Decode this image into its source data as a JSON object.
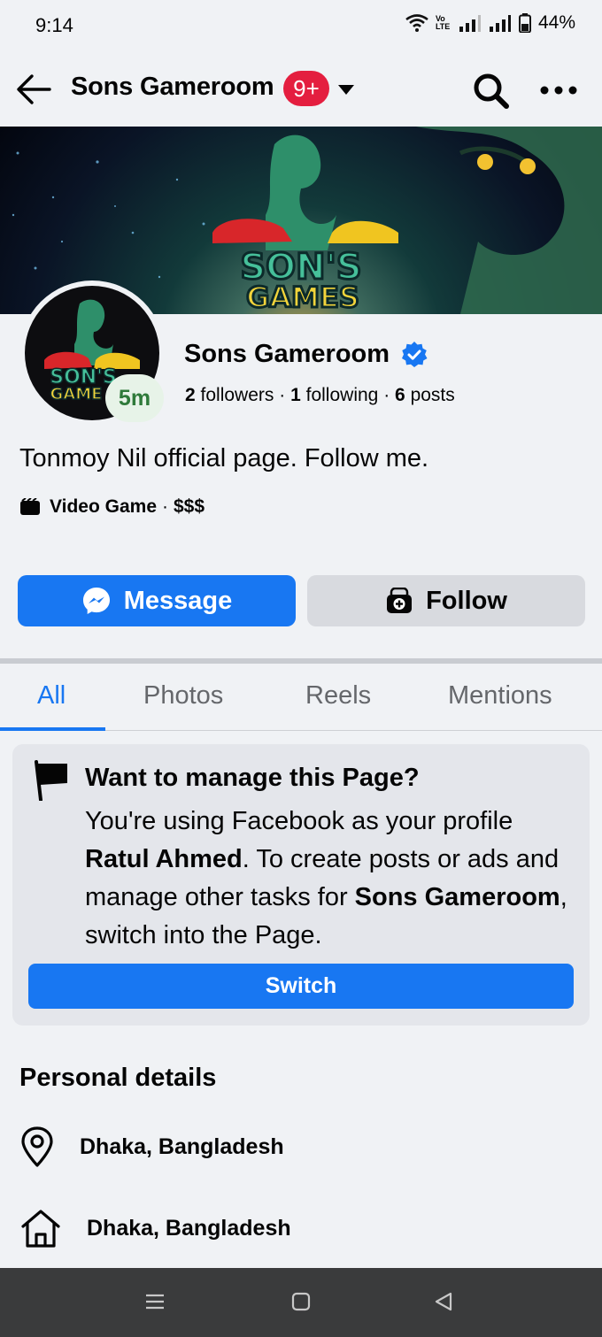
{
  "status_bar": {
    "time": "9:14",
    "battery": "44%",
    "network_label": "Vo LTE"
  },
  "header": {
    "title": "Sons Gameroom",
    "notification_badge": "9+"
  },
  "cover": {
    "logo_line1": "SON'S",
    "logo_line2": "GAMES"
  },
  "profile": {
    "avatar_logo_line1": "SON'S",
    "avatar_logo_line2": "GAME",
    "time_badge": "5m",
    "name": "Sons Gameroom",
    "followers_count": "2",
    "followers_label": "followers",
    "following_count": "1",
    "following_label": "following",
    "posts_count": "6",
    "posts_label": "posts",
    "separator": "·",
    "bio": "Tonmoy Nil official page. Follow me.",
    "category": "Video Game",
    "price_range": "$$$"
  },
  "actions": {
    "message_label": "Message",
    "follow_label": "Follow"
  },
  "tabs": [
    {
      "label": "All"
    },
    {
      "label": "Photos"
    },
    {
      "label": "Reels"
    },
    {
      "label": "Mentions"
    }
  ],
  "manage_card": {
    "title": "Want to manage this Page?",
    "text_part1": "You're using Facebook as your profile ",
    "profile_name": "Ratul Ahmed",
    "text_part2": ". To create posts or ads and manage other tasks for ",
    "page_name": "Sons Gameroom",
    "text_part3": ", switch into the Page.",
    "switch_label": "Switch"
  },
  "personal_details": {
    "title": "Personal details",
    "location": "Dhaka, Bangladesh",
    "hometown": "Dhaka, Bangladesh"
  },
  "colors": {
    "brand_blue": "#1877f2",
    "badge_red": "#e41e3f",
    "page_bg": "#f0f2f5"
  }
}
